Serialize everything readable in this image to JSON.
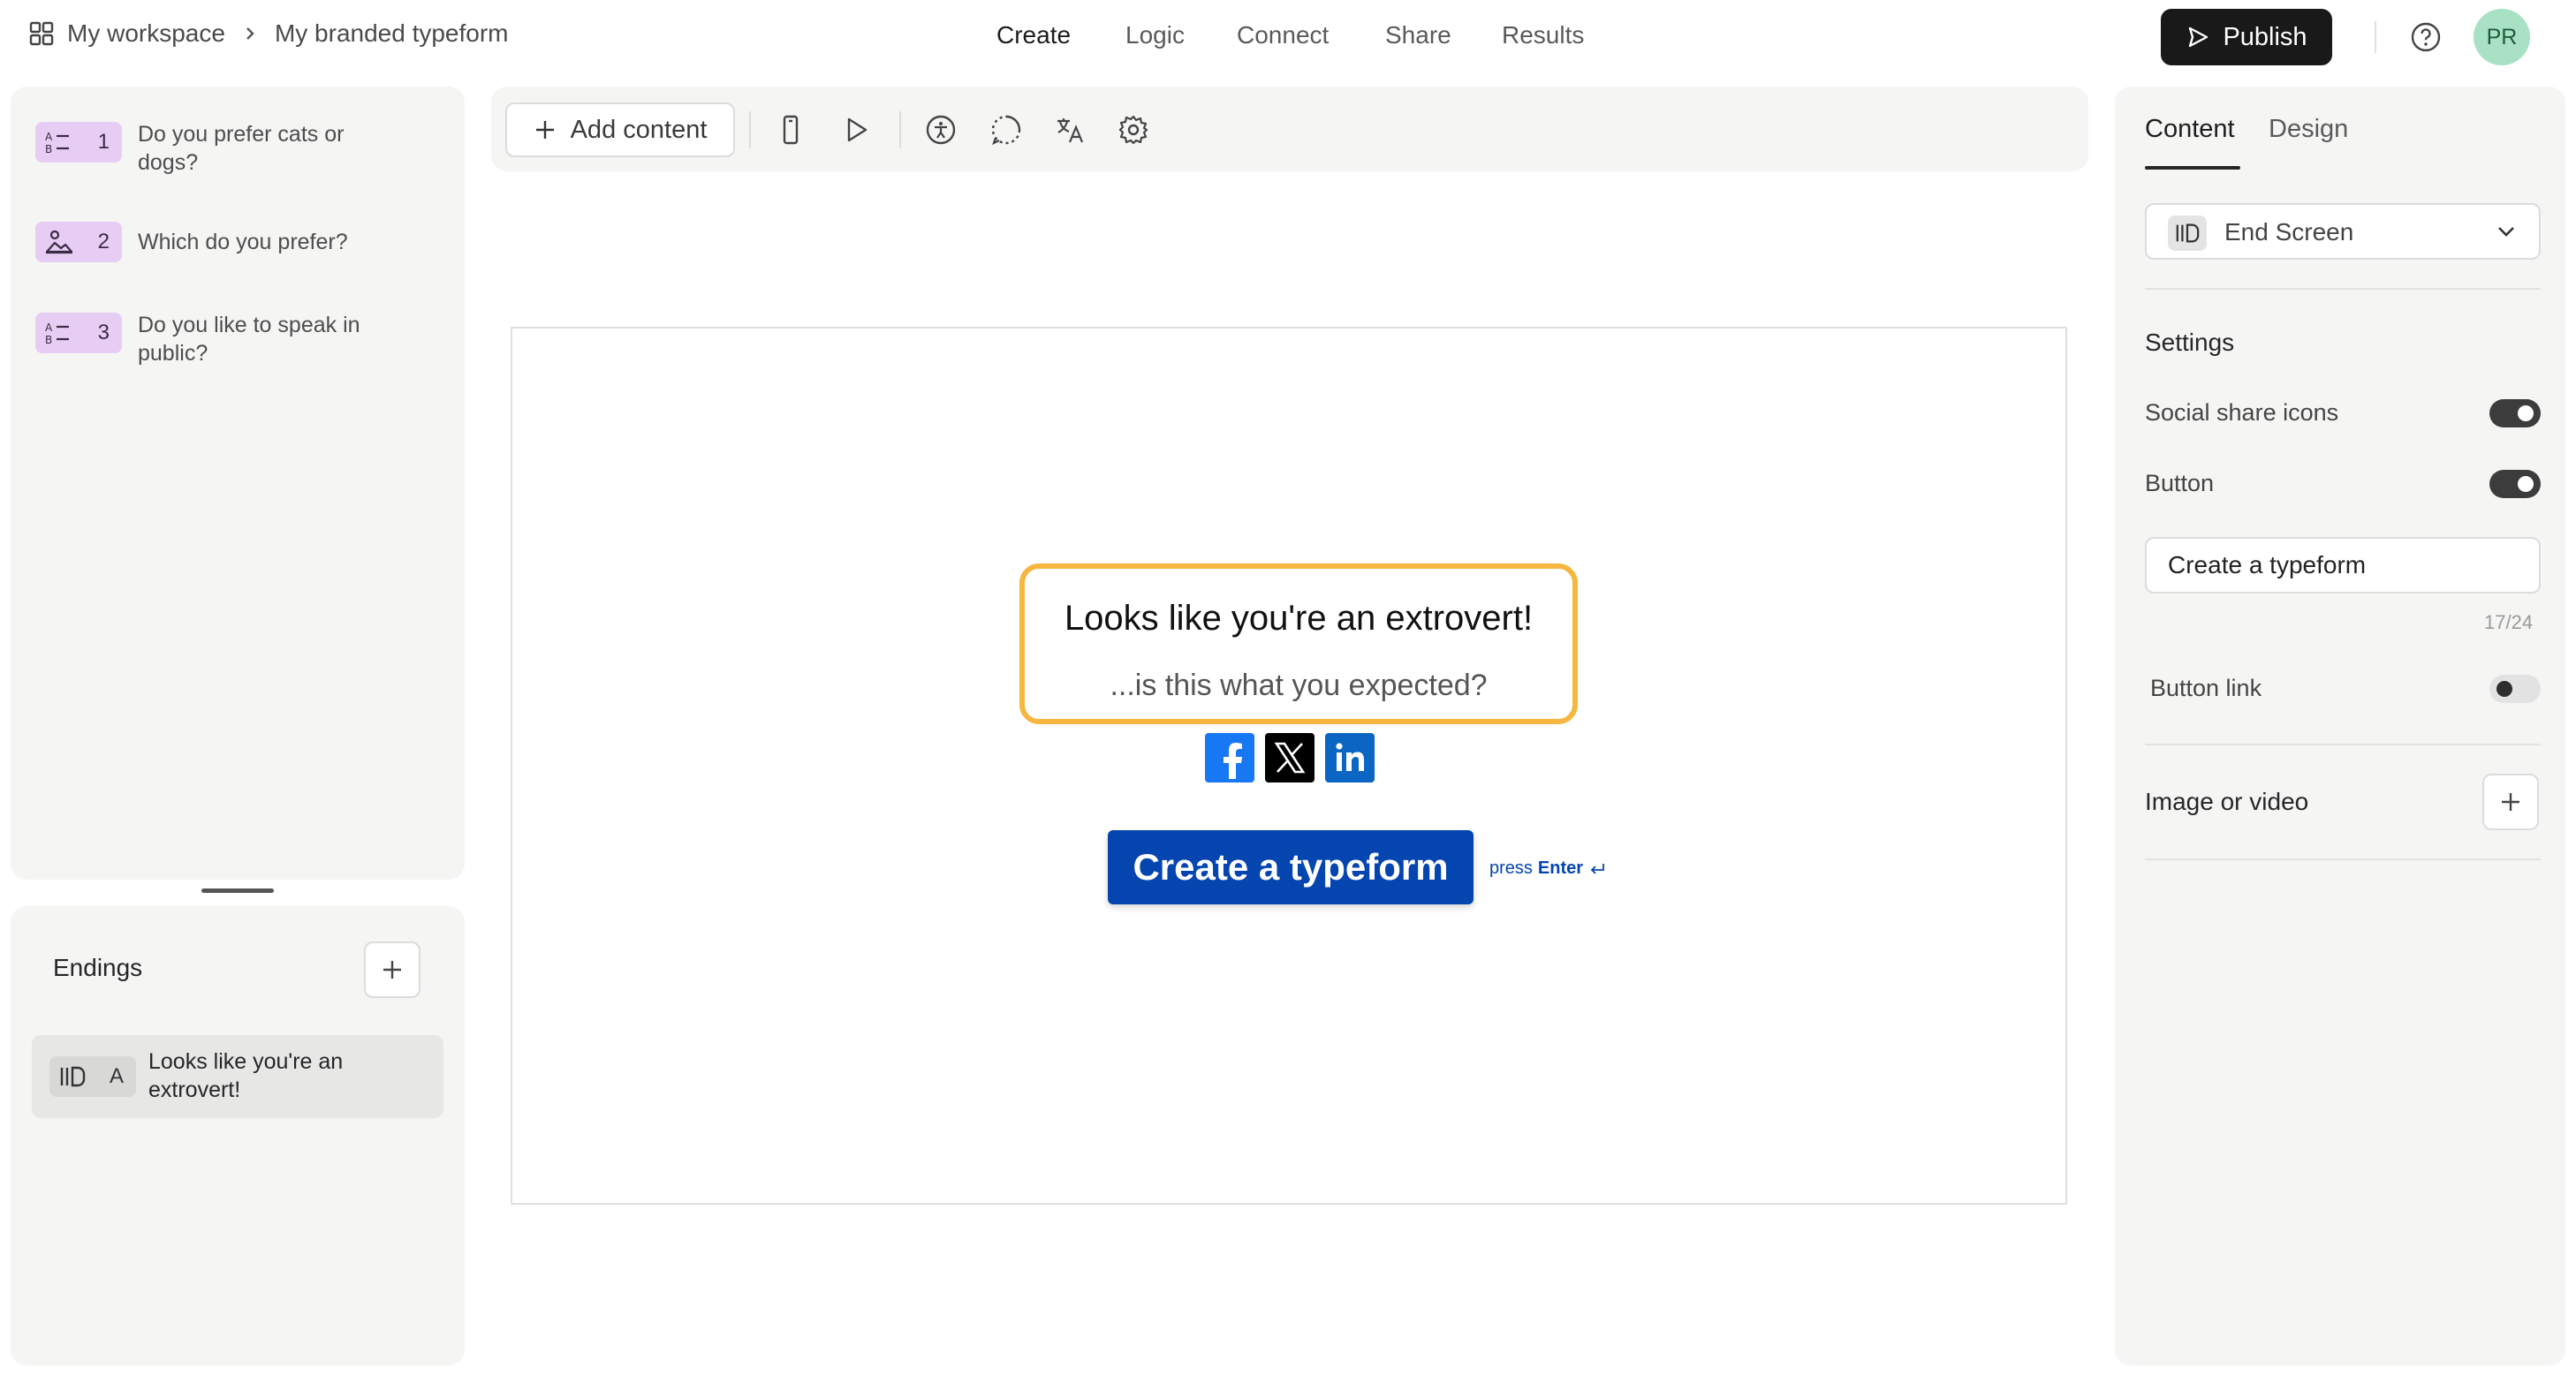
{
  "topbar": {
    "workspace": "My workspace",
    "form_name": "My branded typeform",
    "tabs": [
      "Create",
      "Logic",
      "Connect",
      "Share",
      "Results"
    ],
    "active_tab": "Create",
    "publish_label": "Publish",
    "avatar_initials": "PR"
  },
  "questions": [
    {
      "number": "1",
      "text": "Do you prefer cats or dogs?",
      "icon": "list-choice-icon"
    },
    {
      "number": "2",
      "text": "Which do you prefer?",
      "icon": "picture-choice-icon"
    },
    {
      "number": "3",
      "text": "Do you like to speak in public?",
      "icon": "list-choice-icon"
    }
  ],
  "endings": {
    "title": "Endings",
    "items": [
      {
        "letter": "A",
        "text": "Looks like you're an extrovert!",
        "icon": "end-screen-icon"
      }
    ]
  },
  "toolbar": {
    "add_content_label": "Add content",
    "icons": [
      "mobile-preview-icon",
      "play-icon",
      "accessibility-icon",
      "loading-icon",
      "translate-icon",
      "settings-icon"
    ]
  },
  "preview": {
    "title": "Looks like you're an extrovert!",
    "subtitle": "...is this what you expected?",
    "social": [
      "facebook",
      "x",
      "linkedin"
    ],
    "button_label": "Create a typeform",
    "press_label": "press",
    "enter_label": "Enter",
    "colors": {
      "button": "#0445af",
      "highlight": "#f6b63f"
    }
  },
  "right_panel": {
    "tabs": [
      "Content",
      "Design"
    ],
    "active_tab": "Content",
    "block_type": "End Screen",
    "settings_title": "Settings",
    "social_share_label": "Social share icons",
    "social_share_on": true,
    "button_label": "Button",
    "button_on": true,
    "button_text_value": "Create a typeform",
    "char_count": "17/24",
    "button_link_label": "Button link",
    "button_link_on": false,
    "image_video_label": "Image or video"
  }
}
